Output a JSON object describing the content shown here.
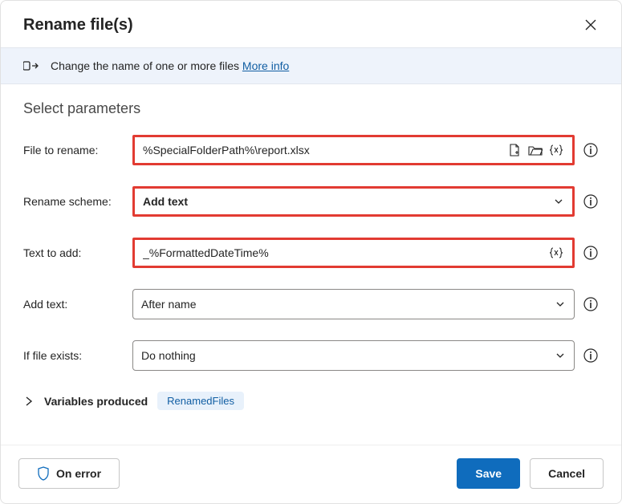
{
  "title": "Rename file(s)",
  "info_bar": {
    "text": "Change the name of one or more files ",
    "link": "More info"
  },
  "section_title": "Select parameters",
  "fields": {
    "file_to_rename": {
      "label": "File to rename:",
      "value": "%SpecialFolderPath%\\report.xlsx"
    },
    "rename_scheme": {
      "label": "Rename scheme:",
      "value": "Add text"
    },
    "text_to_add": {
      "label": "Text to add:",
      "value": "_%FormattedDateTime%"
    },
    "add_text": {
      "label": "Add text:",
      "value": "After name"
    },
    "if_file_exists": {
      "label": "If file exists:",
      "value": "Do nothing"
    }
  },
  "variables": {
    "label": "Variables produced",
    "chip": "RenamedFiles"
  },
  "buttons": {
    "on_error": "On error",
    "save": "Save",
    "cancel": "Cancel"
  }
}
